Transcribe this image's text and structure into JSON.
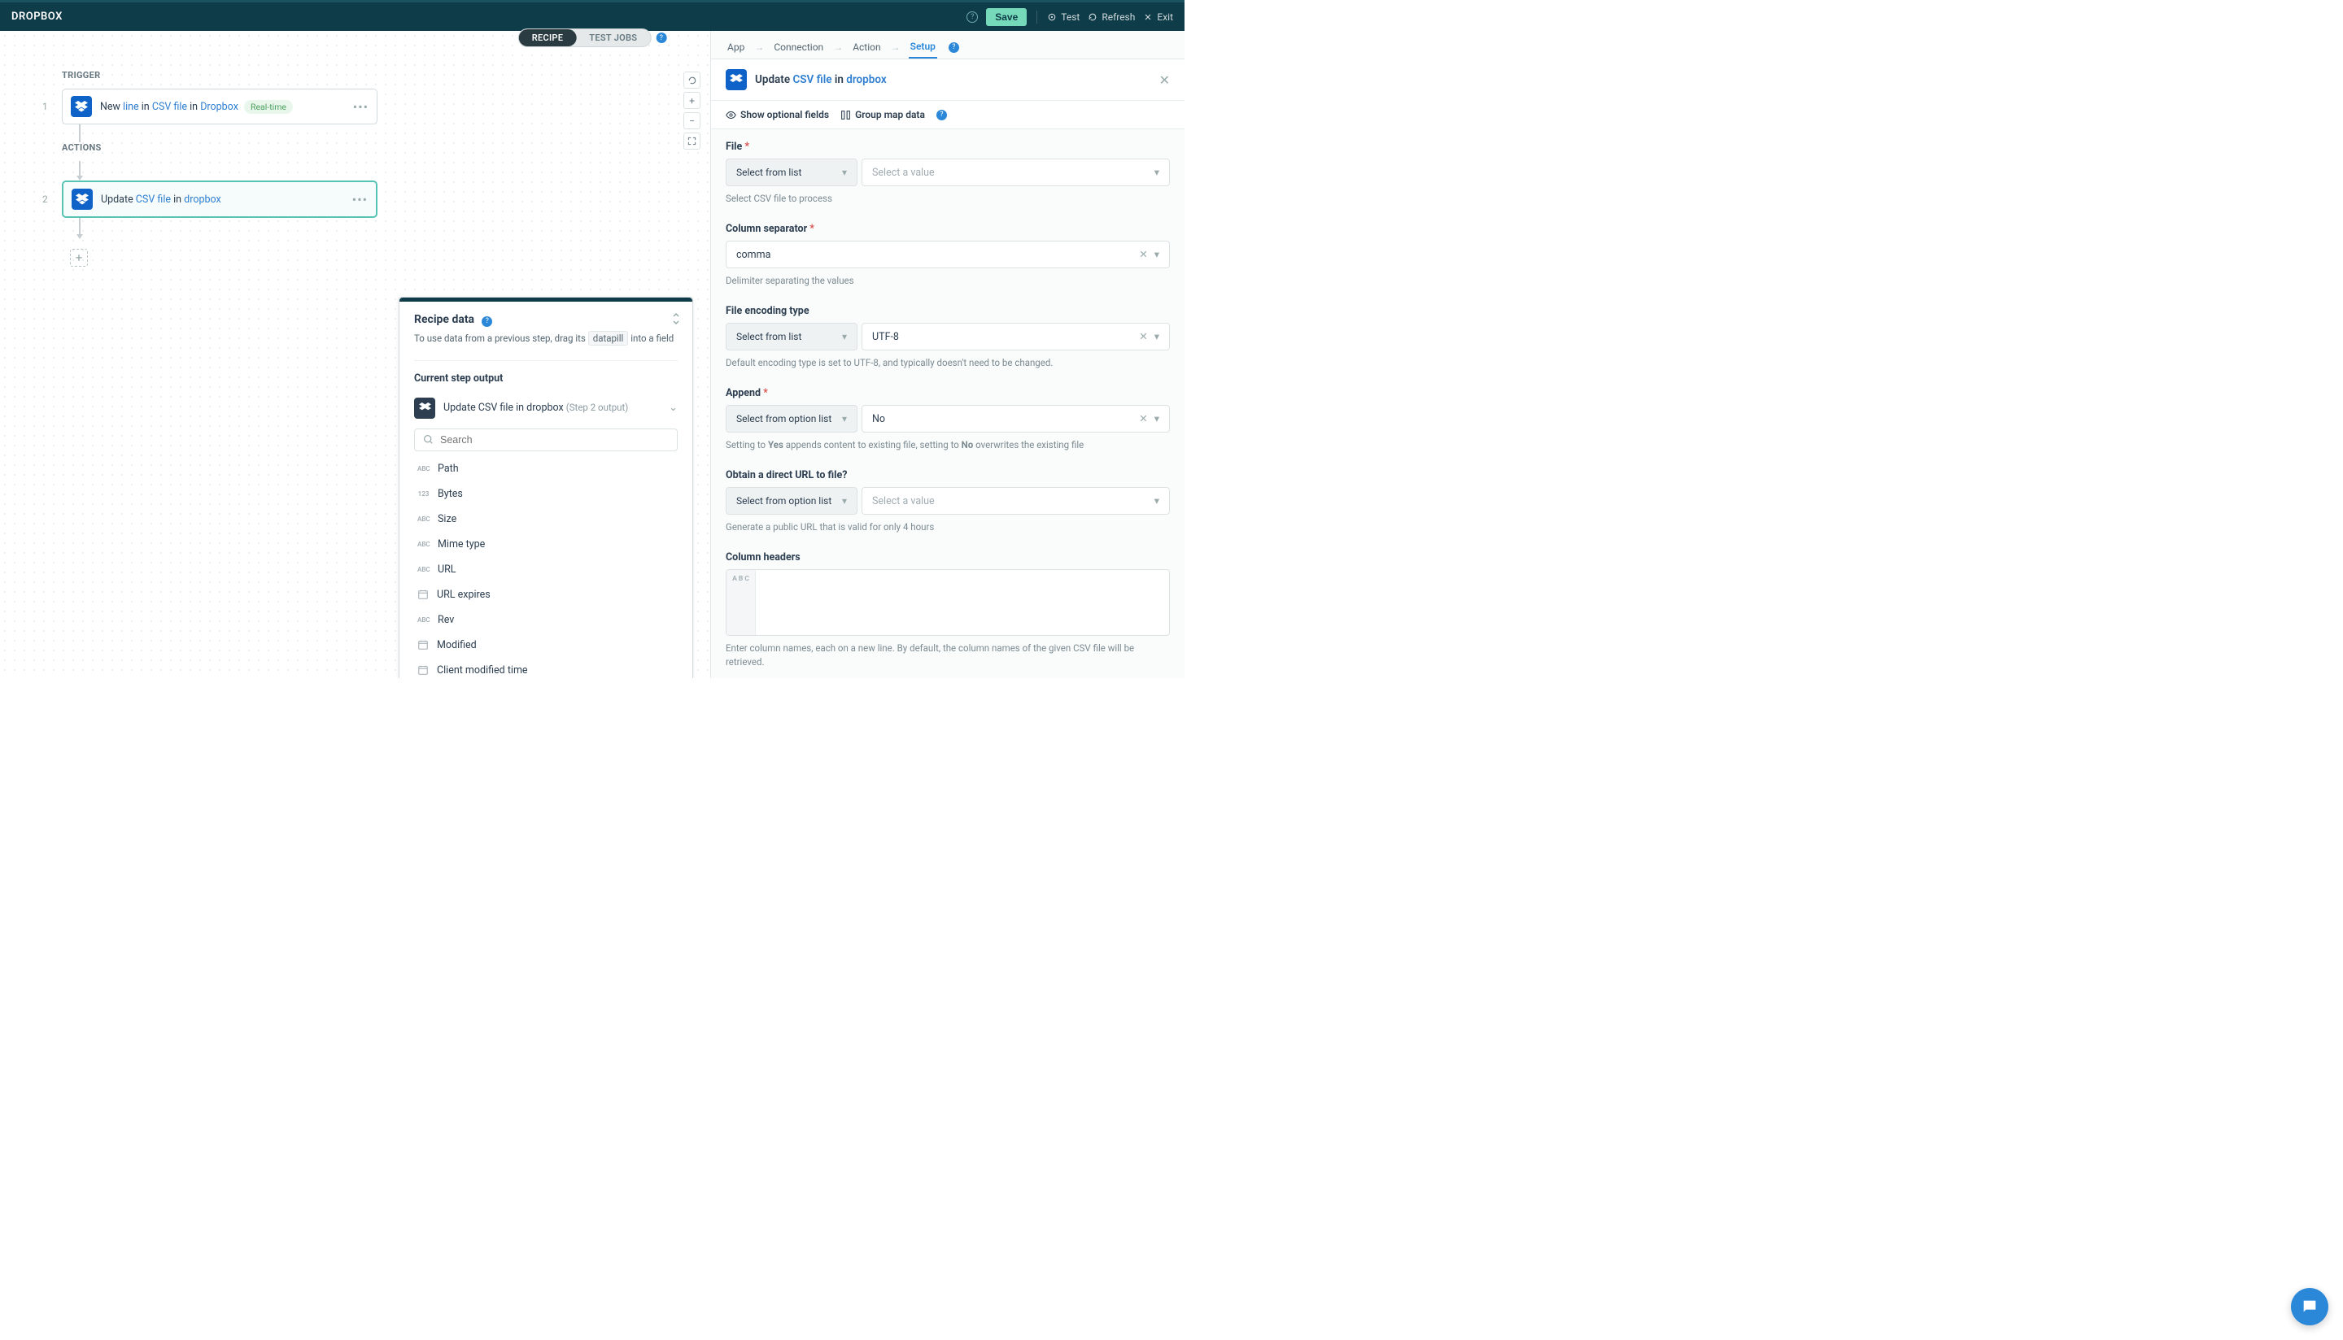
{
  "header": {
    "title": "DROPBOX",
    "saveLabel": "Save",
    "testLabel": "Test",
    "refreshLabel": "Refresh",
    "exitLabel": "Exit"
  },
  "tabs": {
    "recipe": "RECIPE",
    "testJobs": "TEST JOBS"
  },
  "flow": {
    "triggerLabel": "TRIGGER",
    "actionsLabel": "ACTIONS",
    "step1Num": "1",
    "step2Num": "2",
    "step1": {
      "prefix": "New ",
      "link1": "line",
      "mid1": " in ",
      "link2": "CSV file",
      "mid2": " in ",
      "link3": "Dropbox",
      "badge": "Real-time"
    },
    "step2": {
      "prefix": "Update ",
      "link1": "CSV file",
      "mid1": " in ",
      "link2": "dropbox"
    }
  },
  "recipeData": {
    "title": "Recipe data",
    "desc1": "To use data from a previous step, drag its",
    "pill": "datapill",
    "desc2": "into a field",
    "currentStep": "Current step output",
    "stepTitle": "Update CSV file in dropbox",
    "stepSub": "(Step 2 output)",
    "searchPlaceholder": "Search",
    "fields": [
      {
        "type": "ABC",
        "label": "Path"
      },
      {
        "type": "123",
        "label": "Bytes"
      },
      {
        "type": "ABC",
        "label": "Size"
      },
      {
        "type": "ABC",
        "label": "Mime type"
      },
      {
        "type": "ABC",
        "label": "URL"
      },
      {
        "type": "DT",
        "label": "URL expires"
      },
      {
        "type": "ABC",
        "label": "Rev"
      },
      {
        "type": "DT",
        "label": "Modified"
      },
      {
        "type": "DT",
        "label": "Client modified time"
      }
    ]
  },
  "rightPanel": {
    "tabs": {
      "app": "App",
      "connection": "Connection",
      "action": "Action",
      "setup": "Setup"
    },
    "title": {
      "prefix": "Update ",
      "link1": "CSV file",
      "mid": " in ",
      "link2": "dropbox"
    },
    "opts": {
      "showOptional": "Show optional fields",
      "groupMap": "Group map data"
    },
    "form": {
      "file": {
        "label": "File",
        "selectLabel": "Select from list",
        "valuePlaceholder": "Select a value",
        "help": "Select CSV file to process"
      },
      "separator": {
        "label": "Column separator",
        "value": "comma",
        "help": "Delimiter separating the values"
      },
      "encoding": {
        "label": "File encoding type",
        "selectLabel": "Select from list",
        "value": "UTF-8",
        "help": "Default encoding type is set to UTF-8, and typically doesn't need to be changed."
      },
      "append": {
        "label": "Append",
        "selectLabel": "Select from option list",
        "value": "No",
        "help1": "Setting to ",
        "helpB1": "Yes",
        "help2": " appends content to existing file, setting to ",
        "helpB2": "No",
        "help3": " overwrites the existing file"
      },
      "directUrl": {
        "label": "Obtain a direct URL to file?",
        "selectLabel": "Select from option list",
        "valuePlaceholder": "Select a value",
        "help": "Generate a public URL that is valid for only 4 hours"
      },
      "headers": {
        "label": "Column headers",
        "sideLabel": "A B C",
        "help": "Enter column names, each on a new line. By default, the column names of the given CSV file will be retrieved."
      }
    }
  }
}
